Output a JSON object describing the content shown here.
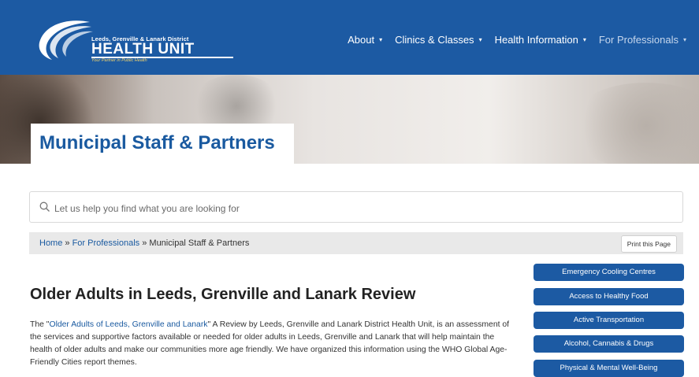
{
  "header": {
    "logo": {
      "line1": "Leeds, Grenville & Lanark District",
      "line2": "HEALTH UNIT",
      "tagline": "Your Partner in Public Health"
    },
    "nav": [
      {
        "label": "About"
      },
      {
        "label": "Clinics & Classes"
      },
      {
        "label": "Health Information"
      },
      {
        "label": "For Professionals"
      }
    ],
    "caret": "▾",
    "colors": {
      "primary": "#1c5aa3",
      "link": "#1a5aa0"
    }
  },
  "hero": {
    "title": "Municipal Staff & Partners"
  },
  "search": {
    "placeholder": "Let us help you find what you are looking for",
    "icon": "search-icon"
  },
  "breadcrumb": {
    "home": "Home",
    "sep1": " » ",
    "section": "For Professionals",
    "sep2": " » ",
    "current": "Municipal Staff & Partners",
    "print": "Print this Page"
  },
  "main": {
    "heading": "Older Adults in Leeds, Grenville and Lanark Review",
    "para_pre": "The \"",
    "para_link": "Older Adults of Leeds, Grenville and Lanark",
    "para_post": "\" A Review by Leeds, Grenville and Lanark District Health Unit, is an assessment of the services and supportive factors available or needed for older adults in Leeds, Grenville and Lanark that will help maintain the health of older adults and make our communities more age friendly. We have organized this information using the WHO Global Age-Friendly Cities report themes."
  },
  "sidebar": {
    "buttons": [
      {
        "label": "Emergency Cooling Centres"
      },
      {
        "label": "Access to Healthy Food"
      },
      {
        "label": "Active Transportation"
      },
      {
        "label": "Alcohol, Cannabis & Drugs"
      },
      {
        "label": "Physical & Mental Well-Being"
      }
    ]
  }
}
